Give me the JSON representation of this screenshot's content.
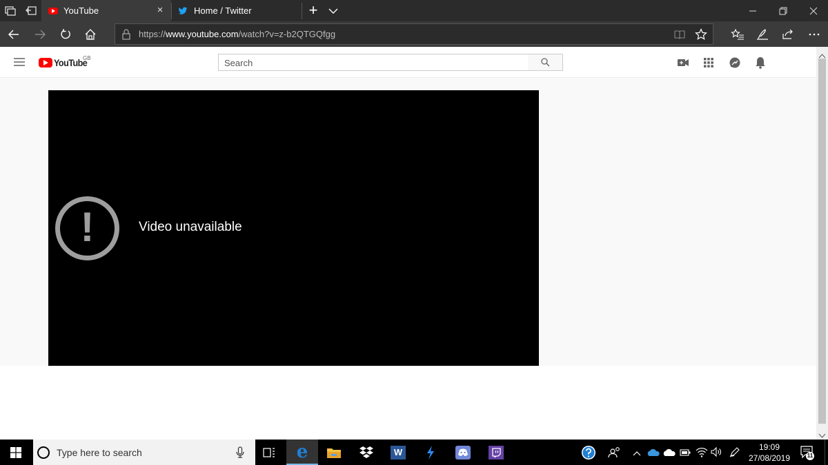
{
  "browser": {
    "tabs": [
      {
        "title": "YouTube",
        "close": "×"
      },
      {
        "title": "Home / Twitter"
      }
    ],
    "new_tab": "+",
    "url_prefix": "https://",
    "url_domain": "www.youtube.com",
    "url_path": "/watch?v=z-b2QTGQfgg"
  },
  "youtube": {
    "logo_text": "YouTube",
    "region": "GB",
    "search_placeholder": "Search"
  },
  "player": {
    "error_message": "Video unavailable",
    "error_glyph": "!"
  },
  "taskbar": {
    "search_placeholder": "Type here to search",
    "notification_count": "11",
    "time": "19:09",
    "date": "27/08/2019",
    "word_letter": "W"
  },
  "colors": {
    "youtube_red": "#ff0000",
    "twitter_blue": "#1da1f2",
    "edge_blue": "#1e7fd6"
  }
}
